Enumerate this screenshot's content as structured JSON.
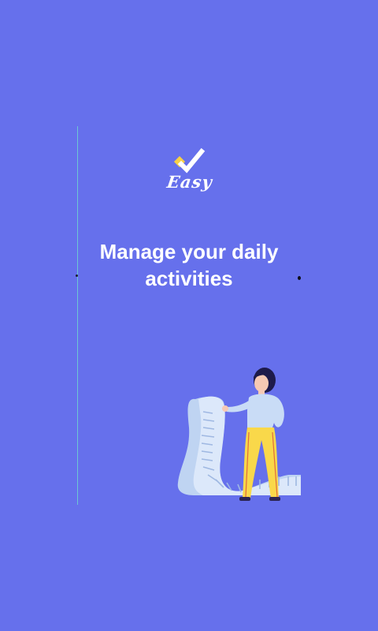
{
  "app": {
    "brand_name": "Easy",
    "colors": {
      "background": "#6670EC",
      "accent_check": "#FFFFFF",
      "accent_square": "#F7D046",
      "guide_line": "#6FD6D0"
    },
    "icons": [
      "checkmark-logo-icon",
      "paper-scroll-icon",
      "woman-figure-icon"
    ]
  },
  "onboarding": {
    "headline_line1": "Manage your daily",
    "headline_line2": "activities"
  }
}
